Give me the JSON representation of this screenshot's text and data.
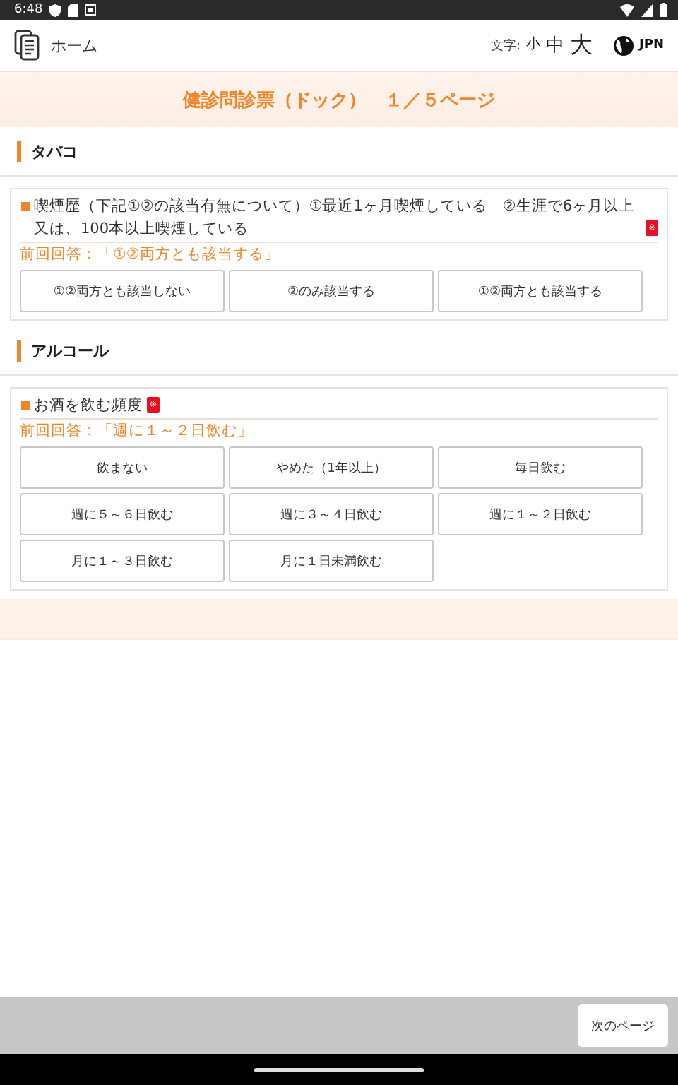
{
  "status_bar": {
    "time": "6:48"
  },
  "header": {
    "home_label": "ホーム",
    "text_size_label": "文字:",
    "size_options": [
      "小",
      "中",
      "大"
    ],
    "language": "JPN"
  },
  "title": "健診問診票（ドック）　１／５ページ",
  "sections": [
    {
      "title": "タバコ",
      "questions": [
        {
          "text": "喫煙歴（下記①②の該当有無について）①最近1ヶ月喫煙している　②生涯で6ヶ月以上又は、100本以上喫煙している",
          "required_mark": "※",
          "previous_answer": "前回回答：「①②両方とも該当する」",
          "options": [
            {
              "label": "①②両方とも該当しない",
              "selected": false
            },
            {
              "label": "②のみ該当する",
              "selected": false
            },
            {
              "label": "①②両方とも該当する",
              "selected": false
            }
          ]
        }
      ]
    },
    {
      "title": "アルコール",
      "questions": [
        {
          "text": "お酒を飲む頻度",
          "required_mark": "※",
          "previous_answer": "前回回答：「週に１～２日飲む」",
          "options": [
            {
              "label": "飲まない",
              "selected": false
            },
            {
              "label": "やめた（1年以上）",
              "selected": false
            },
            {
              "label": "毎日飲む",
              "selected": false
            },
            {
              "label": "週に５～６日飲む",
              "selected": false
            },
            {
              "label": "週に３～４日飲む",
              "selected": false
            },
            {
              "label": "週に１～２日飲む",
              "selected": false
            },
            {
              "label": "月に１～３日飲む",
              "selected": false
            },
            {
              "label": "月に１日未満飲む",
              "selected": false
            }
          ]
        }
      ]
    }
  ],
  "footer": {
    "next_button": "次のページ"
  }
}
